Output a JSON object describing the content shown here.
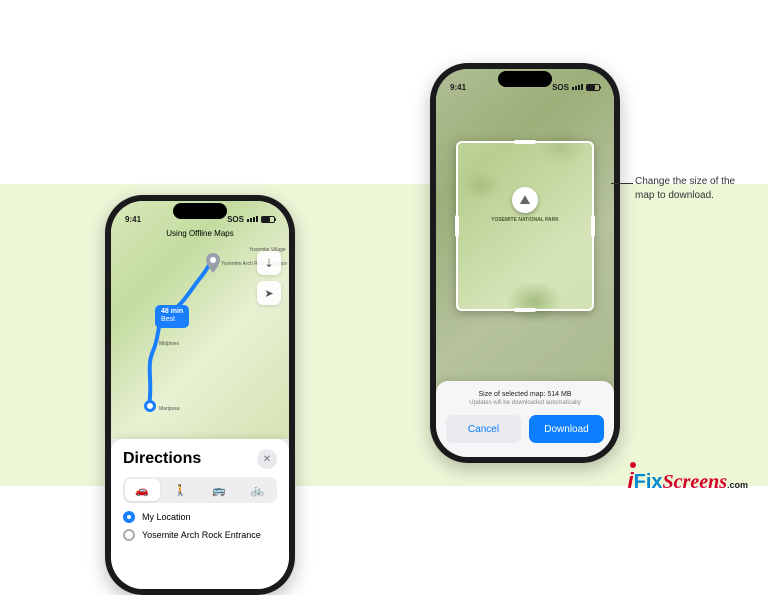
{
  "left": {
    "status_time": "9:41",
    "status_conn": "SOS",
    "title": "Using Offline Maps",
    "route_bubble_line1": "48 min",
    "route_bubble_line2": "Best",
    "place_yosvillage": "Yosemite\nVillage",
    "place_dest": "Yosemite Arch\nRock Entrance",
    "place_midpines": "Midpines",
    "place_mariposa": "Mariposa",
    "sheet_title": "Directions",
    "close_glyph": "✕",
    "mode_car": "🚗",
    "mode_walk": "🚶",
    "mode_transit": "🚌",
    "mode_bike": "🚲",
    "ctrl_offline": "⇣",
    "ctrl_locate": "➤",
    "waypoints": {
      "a": "My Location",
      "b": "Yosemite Arch Rock Entrance"
    }
  },
  "right": {
    "status_time": "9:41",
    "status_conn": "SOS",
    "park_name": "YOSEMITE\nNATIONAL\nPARK",
    "park_icon": "⛰",
    "size_line": "Size of selected map: 514 MB",
    "hint_line": "Updates will be downloaded automatically",
    "cancel": "Cancel",
    "download": "Download"
  },
  "callout": "Change the size of the map to download.",
  "logo": {
    "i": "i",
    "fix": "Fix",
    "scr": "Screens",
    "com": ".com"
  }
}
